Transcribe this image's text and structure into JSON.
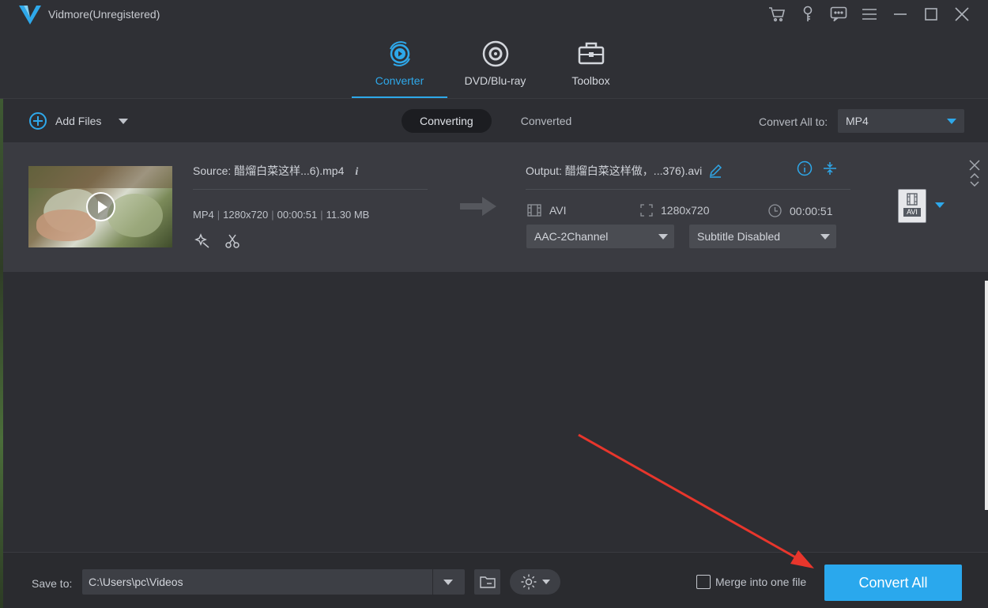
{
  "app": {
    "title": "Vidmore(Unregistered)"
  },
  "titlebar_icons": [
    "cart-icon",
    "key-icon",
    "feedback-icon",
    "menu-icon",
    "minimize-icon",
    "maximize-icon",
    "close-icon"
  ],
  "nav": {
    "tabs": [
      {
        "label": "Converter",
        "active": true
      },
      {
        "label": "DVD/Blu-ray",
        "active": false
      },
      {
        "label": "Toolbox",
        "active": false
      }
    ]
  },
  "toolbar": {
    "add_files": "Add Files",
    "subtabs": [
      {
        "label": "Converting",
        "active": true
      },
      {
        "label": "Converted",
        "active": false
      }
    ],
    "convert_all_to_label": "Convert All to:",
    "convert_all_to_value": "MP4"
  },
  "file": {
    "source": "Source: 醋熘白菜这样...6).mp4",
    "format": "MP4",
    "resolution": "1280x720",
    "duration": "00:00:51",
    "size": "11.30 MB",
    "output": "Output: 醋熘白菜这样做，...376).avi",
    "out_format": "AVI",
    "out_resolution": "1280x720",
    "out_duration": "00:00:51",
    "audio": "AAC-2Channel",
    "subtitle": "Subtitle Disabled",
    "format_badge": "AVI"
  },
  "bottom": {
    "save_to_label": "Save to:",
    "save_path": "C:\\Users\\pc\\Videos",
    "merge_label": "Merge into one file",
    "merge_checked": false,
    "convert_button": "Convert All"
  },
  "colors": {
    "accent": "#2ea8ea",
    "annotation": "#e8362c"
  }
}
